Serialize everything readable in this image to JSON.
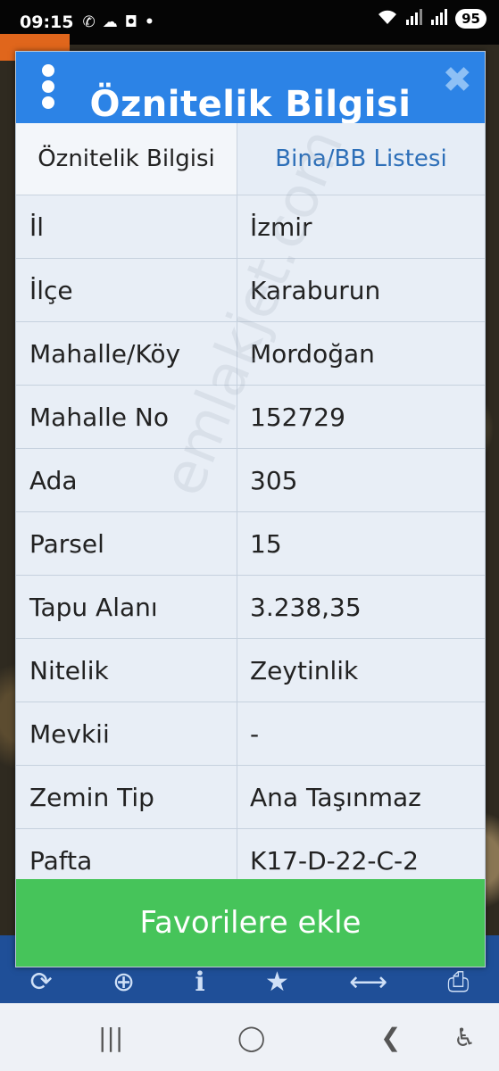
{
  "status_bar": {
    "time": "09:15",
    "notification_icons": [
      "whatsapp-icon",
      "cloud-icon",
      "instagram-icon",
      "dot"
    ],
    "battery": "95"
  },
  "dialog": {
    "title": "Öznitelik Bilgisi",
    "close_symbol": "✖",
    "tabs": [
      {
        "label": "Öznitelik Bilgisi",
        "active": true
      },
      {
        "label": "Bina/BB Listesi",
        "active": false
      }
    ],
    "rows": [
      {
        "label": "İl",
        "value": "İzmir"
      },
      {
        "label": "İlçe",
        "value": "Karaburun"
      },
      {
        "label": "Mahalle/Köy",
        "value": "Mordoğan"
      },
      {
        "label": "Mahalle No",
        "value": "152729"
      },
      {
        "label": "Ada",
        "value": "305"
      },
      {
        "label": "Parsel",
        "value": "15"
      },
      {
        "label": "Tapu Alanı",
        "value": "3.238,35"
      },
      {
        "label": "Nitelik",
        "value": "Zeytinlik"
      },
      {
        "label": "Mevkii",
        "value": "-"
      },
      {
        "label": "Zemin Tip",
        "value": "Ana Taşınmaz"
      },
      {
        "label": "Pafta",
        "value": "K17-D-22-C-2"
      }
    ],
    "favorite_button": "Favorilere ekle",
    "watermark": "emlakjet.com"
  },
  "colors": {
    "header_blue": "#2c83e6",
    "favorite_green": "#46c45a",
    "tab_link_blue": "#2d6fb8"
  }
}
